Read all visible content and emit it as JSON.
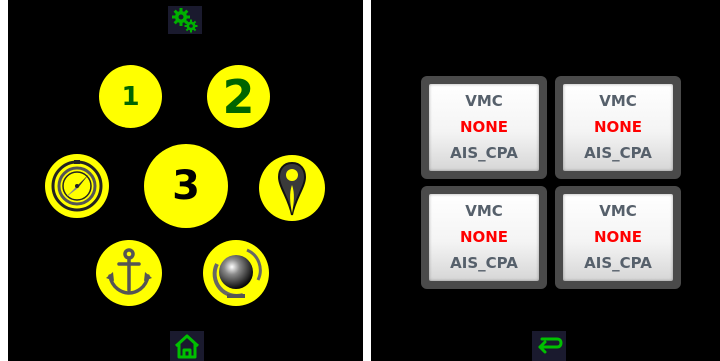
{
  "left_panel": {
    "top_icon": "gears-icon",
    "bottom_icon": "home-icon",
    "buttons": [
      {
        "id": "button-1",
        "label": "1",
        "color": "#006400"
      },
      {
        "id": "button-2",
        "label": "2",
        "color": "#006400"
      },
      {
        "id": "button-3",
        "label": "3",
        "color": "#000000"
      },
      {
        "id": "compass",
        "icon": "compass-icon"
      },
      {
        "id": "location",
        "icon": "location-pin-icon"
      },
      {
        "id": "anchor",
        "icon": "anchor-icon"
      },
      {
        "id": "globe",
        "icon": "globe-icon"
      }
    ],
    "accent_color": "#ffff00",
    "icon_color": "#00a000"
  },
  "right_panel": {
    "tiles": [
      {
        "line1": "VMC",
        "line2": "NONE",
        "line3": "AIS_CPA"
      },
      {
        "line1": "VMC",
        "line2": "NONE",
        "line3": "AIS_CPA"
      },
      {
        "line1": "VMC",
        "line2": "NONE",
        "line3": "AIS_CPA"
      },
      {
        "line1": "VMC",
        "line2": "NONE",
        "line3": "AIS_CPA"
      }
    ],
    "bottom_icon": "back-arrow-icon",
    "value_color": "#ff0000",
    "label_color": "#56606b"
  }
}
